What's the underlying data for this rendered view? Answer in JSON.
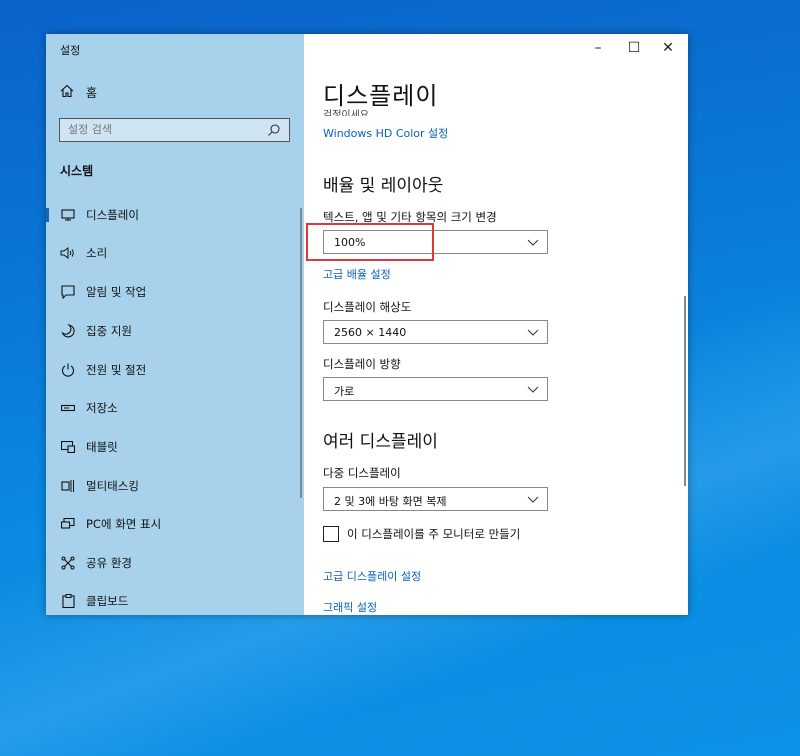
{
  "window": {
    "title": "설정",
    "controls": {
      "minimize": "–",
      "maximize": "☐",
      "close": "✕"
    }
  },
  "sidebar": {
    "home": "홈",
    "search_placeholder": "설정 검색",
    "section": "시스템",
    "items": [
      {
        "label": "디스플레이",
        "icon": "monitor-icon",
        "active": true
      },
      {
        "label": "소리",
        "icon": "speaker-icon"
      },
      {
        "label": "알림 및 작업",
        "icon": "notification-icon"
      },
      {
        "label": "집중 지원",
        "icon": "moon-icon"
      },
      {
        "label": "전원 및 절전",
        "icon": "power-icon"
      },
      {
        "label": "저장소",
        "icon": "storage-icon"
      },
      {
        "label": "태블릿",
        "icon": "tablet-icon"
      },
      {
        "label": "멀티태스킹",
        "icon": "multitasking-icon"
      },
      {
        "label": "PC에 화면 표시",
        "icon": "project-icon"
      },
      {
        "label": "공유 환경",
        "icon": "shared-experiences-icon"
      },
      {
        "label": "클립보드",
        "icon": "clipboard-icon"
      }
    ]
  },
  "main": {
    "heading": "디스플레이",
    "cut_text": "검정이세요.",
    "hd_color_link": "Windows HD Color 설정",
    "scale_section": "배율 및 레이아웃",
    "scale_label": "텍스트, 앱 및 기타 항목의 크기 변경",
    "scale_value": "100%",
    "advanced_scale_link": "고급 배율 설정",
    "resolution_label": "디스플레이 해상도",
    "resolution_value": "2560 × 1440",
    "orientation_label": "디스플레이 방향",
    "orientation_value": "가로",
    "multi_section": "여러 디스플레이",
    "multi_label": "다중 디스플레이",
    "multi_value": "2 및 3에 바탕 화면 복제",
    "main_display_label": "이 디스플레이를 주 모니터로 만들기",
    "advanced_display_link": "고급 디스플레이 설정",
    "graphics_link": "그래픽 설정"
  },
  "colors": {
    "accent": "#0a60c0",
    "sidebar_bg": "#a8d2ec",
    "highlight": "#e0373a"
  }
}
